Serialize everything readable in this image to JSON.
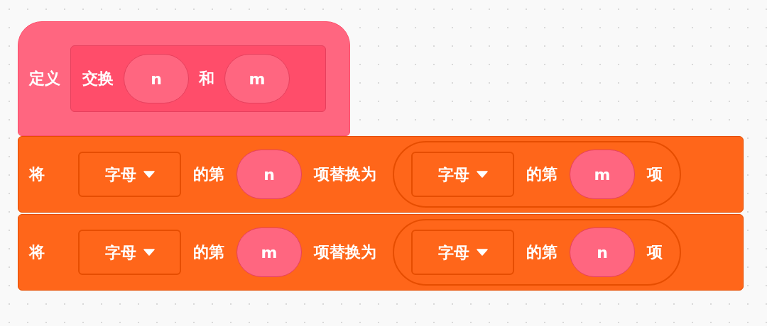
{
  "define_block": {
    "label": "定义",
    "prototype": [
      {
        "kind": "text",
        "text": "交换"
      },
      {
        "kind": "param",
        "text": "n"
      },
      {
        "kind": "text",
        "text": "和"
      },
      {
        "kind": "param",
        "text": "m"
      }
    ]
  },
  "blocks": [
    {
      "parts": [
        {
          "kind": "text",
          "text": "将"
        },
        {
          "kind": "dropdown",
          "text": "字母"
        },
        {
          "kind": "text",
          "text": "的第"
        },
        {
          "kind": "param",
          "text": "n"
        },
        {
          "kind": "text",
          "text": "项替换为"
        },
        {
          "kind": "reporter",
          "parts": [
            {
              "kind": "dropdown",
              "text": "字母"
            },
            {
              "kind": "text",
              "text": "的第"
            },
            {
              "kind": "param",
              "text": "m"
            },
            {
              "kind": "text",
              "text": "项"
            }
          ]
        }
      ]
    },
    {
      "parts": [
        {
          "kind": "text",
          "text": "将"
        },
        {
          "kind": "dropdown",
          "text": "字母"
        },
        {
          "kind": "text",
          "text": "的第"
        },
        {
          "kind": "param",
          "text": "m"
        },
        {
          "kind": "text",
          "text": "项替换为"
        },
        {
          "kind": "reporter",
          "parts": [
            {
              "kind": "dropdown",
              "text": "字母"
            },
            {
              "kind": "text",
              "text": "的第"
            },
            {
              "kind": "param",
              "text": "n"
            },
            {
              "kind": "text",
              "text": "项"
            }
          ]
        }
      ]
    }
  ]
}
